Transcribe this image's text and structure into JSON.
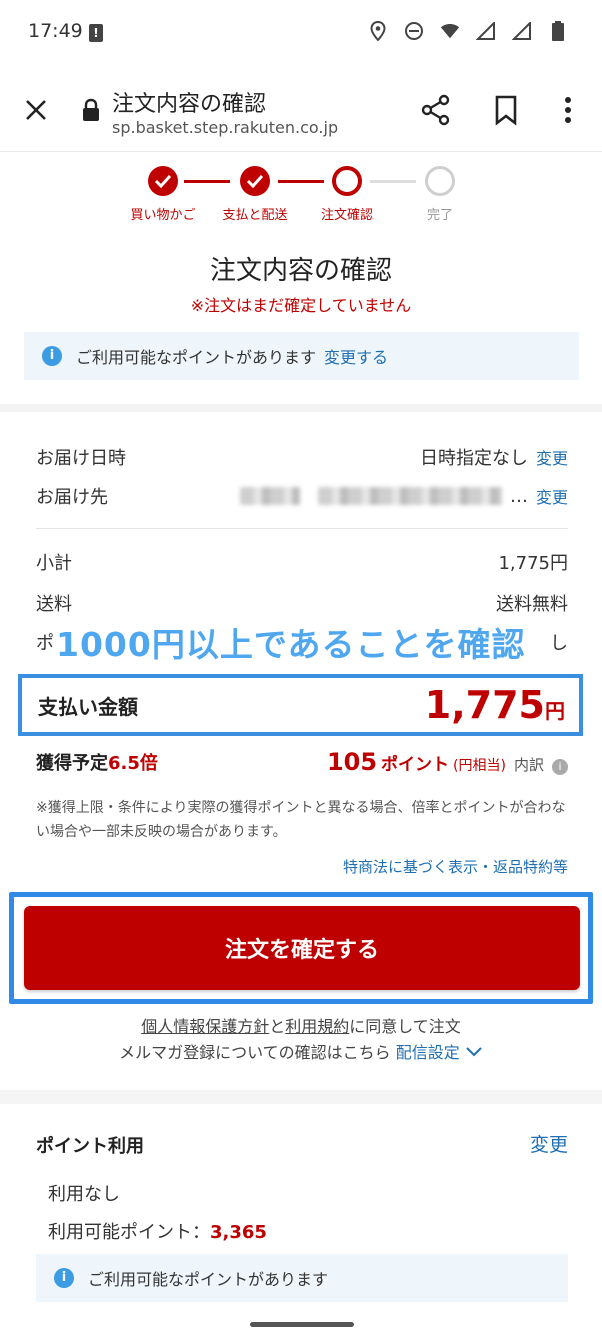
{
  "status_bar": {
    "time": "17:49"
  },
  "toolbar": {
    "title": "注文内容の確認",
    "url": "sp.basket.step.rakuten.co.jp"
  },
  "stepper": {
    "steps": [
      {
        "label": "買い物かご",
        "state": "done"
      },
      {
        "label": "支払と配送",
        "state": "done"
      },
      {
        "label": "注文確認",
        "state": "current"
      },
      {
        "label": "完了",
        "state": "future"
      }
    ]
  },
  "heading": "注文内容の確認",
  "warning": "※注文はまだ確定していません",
  "info_banner": {
    "text": "ご利用可能なポイントがあります",
    "link": "変更する"
  },
  "delivery": {
    "date_label": "お届け日時",
    "date_value": "日時指定なし",
    "date_change": "変更",
    "address_label": "お届け先",
    "address_ellipsis": "…",
    "address_change": "変更"
  },
  "summary": {
    "subtotal_label": "小計",
    "subtotal_value": "1,775円",
    "shipping_label": "送料",
    "shipping_value": "送料無料",
    "points_label_partial": "ポ",
    "points_value_partial": "し"
  },
  "overlay": {
    "text": "1000円以上であることを確認"
  },
  "total": {
    "label": "支払い金額",
    "amount": "1,775",
    "unit": "円"
  },
  "points_gain": {
    "label": "獲得予定",
    "multiplier": "6.5倍",
    "amount": "105",
    "unit": "ポイント",
    "yen_equiv": "(円相当)",
    "detail": "内訳"
  },
  "note": "※獲得上限・条件により実際の獲得ポイントと異なる場合、倍率とポイントが合わない場合や一部未反映の場合があります。",
  "law_link": "特商法に基づく表示・返品特約等",
  "confirm_button": "注文を確定する",
  "agreement": {
    "privacy": "個人情報保護方針",
    "and": "と",
    "terms": "利用規約",
    "suffix": "に同意して注文",
    "mail_text": "メルマガ登録についての確認はこちら",
    "mail_link": "配信設定"
  },
  "point_usage": {
    "title": "ポイント利用",
    "change": "変更",
    "usage": "利用なし",
    "available_label": "利用可能ポイント：",
    "available_value": "3,365",
    "info": "ご利用可能なポイントがあります"
  },
  "colors": {
    "brand_red": "#bf0000",
    "link_blue": "#1f6fb2",
    "highlight_blue": "#2f8be6"
  }
}
